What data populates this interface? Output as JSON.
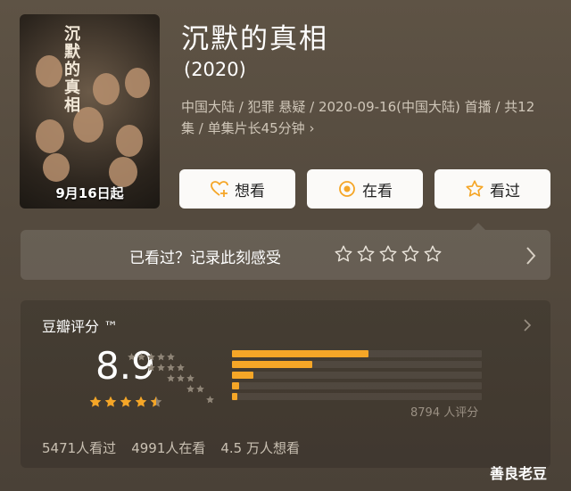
{
  "poster": {
    "title_calligraphy": "沉默的真相",
    "date_label": "9月16日起"
  },
  "title": "沉默的真相",
  "year": "(2020)",
  "meta": "中国大陆 / 犯罪 悬疑 / 2020-09-16(中国大陆) 首播 / 共12集 / 单集片长45分钟 ›",
  "actions": {
    "want": "想看",
    "doing": "在看",
    "done": "看过"
  },
  "rate_prompt": {
    "text": "已看过？记录此刻感受",
    "stars": 5
  },
  "score_card": {
    "title": "豆瓣评分 ™",
    "score": "8.9",
    "stars": 4.5,
    "distribution_percent": [
      54.5,
      32.0,
      8.5,
      3.0,
      2.0
    ],
    "raters": "8794 人评分",
    "stats": {
      "watched": "5471人看过",
      "watching": "4991人在看",
      "wanted": "4.5 万人想看"
    }
  },
  "colors": {
    "accent": "#f5a627",
    "bg": "#5a4f42"
  },
  "watermark": "善良老豆"
}
